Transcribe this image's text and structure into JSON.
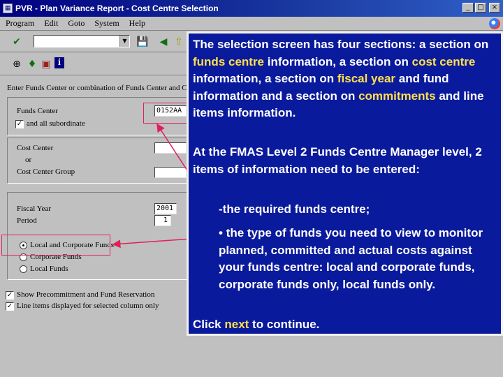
{
  "window": {
    "title": "PVR - Plan Variance Report - Cost Centre Selection",
    "controls": {
      "minimize": "_",
      "maximize": "□",
      "close": "×"
    }
  },
  "menu": [
    "Program",
    "Edit",
    "Goto",
    "System",
    "Help"
  ],
  "toolbar": {
    "command_field_value": "",
    "icons": [
      "check-icon",
      "save-icon",
      "back-icon",
      "exit-icon",
      "cancel-icon",
      "print-icon",
      "find-icon"
    ],
    "secondary_icons": [
      "execute-icon",
      "variant-icon",
      "copy-icon",
      "info-icon"
    ]
  },
  "form": {
    "section_heading": "Enter Funds Center or combination of Funds Center and Cost Center",
    "funds_center": {
      "label": "Funds Center",
      "value": "0152AA"
    },
    "all_subordinate": {
      "label": "and all subordinate",
      "checked": true
    },
    "cost_center": {
      "label": "Cost Center",
      "value": ""
    },
    "or_label": "or",
    "cost_center_group": {
      "label": "Cost Center Group",
      "value": ""
    },
    "fiscal_year": {
      "label": "Fiscal Year",
      "value": "2001"
    },
    "period": {
      "label": "Period",
      "value": "1"
    },
    "fund_options": [
      {
        "label": "Local and Corporate Funds",
        "selected": true
      },
      {
        "label": "Corporate Funds",
        "selected": false
      },
      {
        "label": "Local Funds",
        "selected": false
      }
    ],
    "show_precommitment": {
      "label": "Show Precommitment and Fund Reservation",
      "checked": true
    },
    "line_items": {
      "label": "Line items displayed for selected column only",
      "checked": true
    }
  },
  "panel": {
    "p1_a": "The selection screen has four sections: a section on ",
    "p1_h1": "funds centre",
    "p1_b": " information, a section on ",
    "p1_h2": "cost centre",
    "p1_c": " information, a section on ",
    "p1_h3": "fiscal year",
    "p1_d": " and fund information and a section on ",
    "p1_h4": "commitments",
    "p1_e": " and line items information.",
    "p2": "At the FMAS Level 2 Funds Centre Manager level, 2 items of information need to be entered:",
    "bullet1": "-the required funds centre;",
    "bullet2": "• the type of funds you need to view to monitor planned, committed and actual costs against your funds centre: local and corporate funds, corporate funds only, local funds only.",
    "p3_a": "Click ",
    "p3_h": "next",
    "p3_b": " to continue."
  },
  "colors": {
    "panel_bg": "#0a1a9c",
    "highlight_text": "#ffe14d",
    "annotation": "#e0205a",
    "titlebar": "#000080"
  }
}
